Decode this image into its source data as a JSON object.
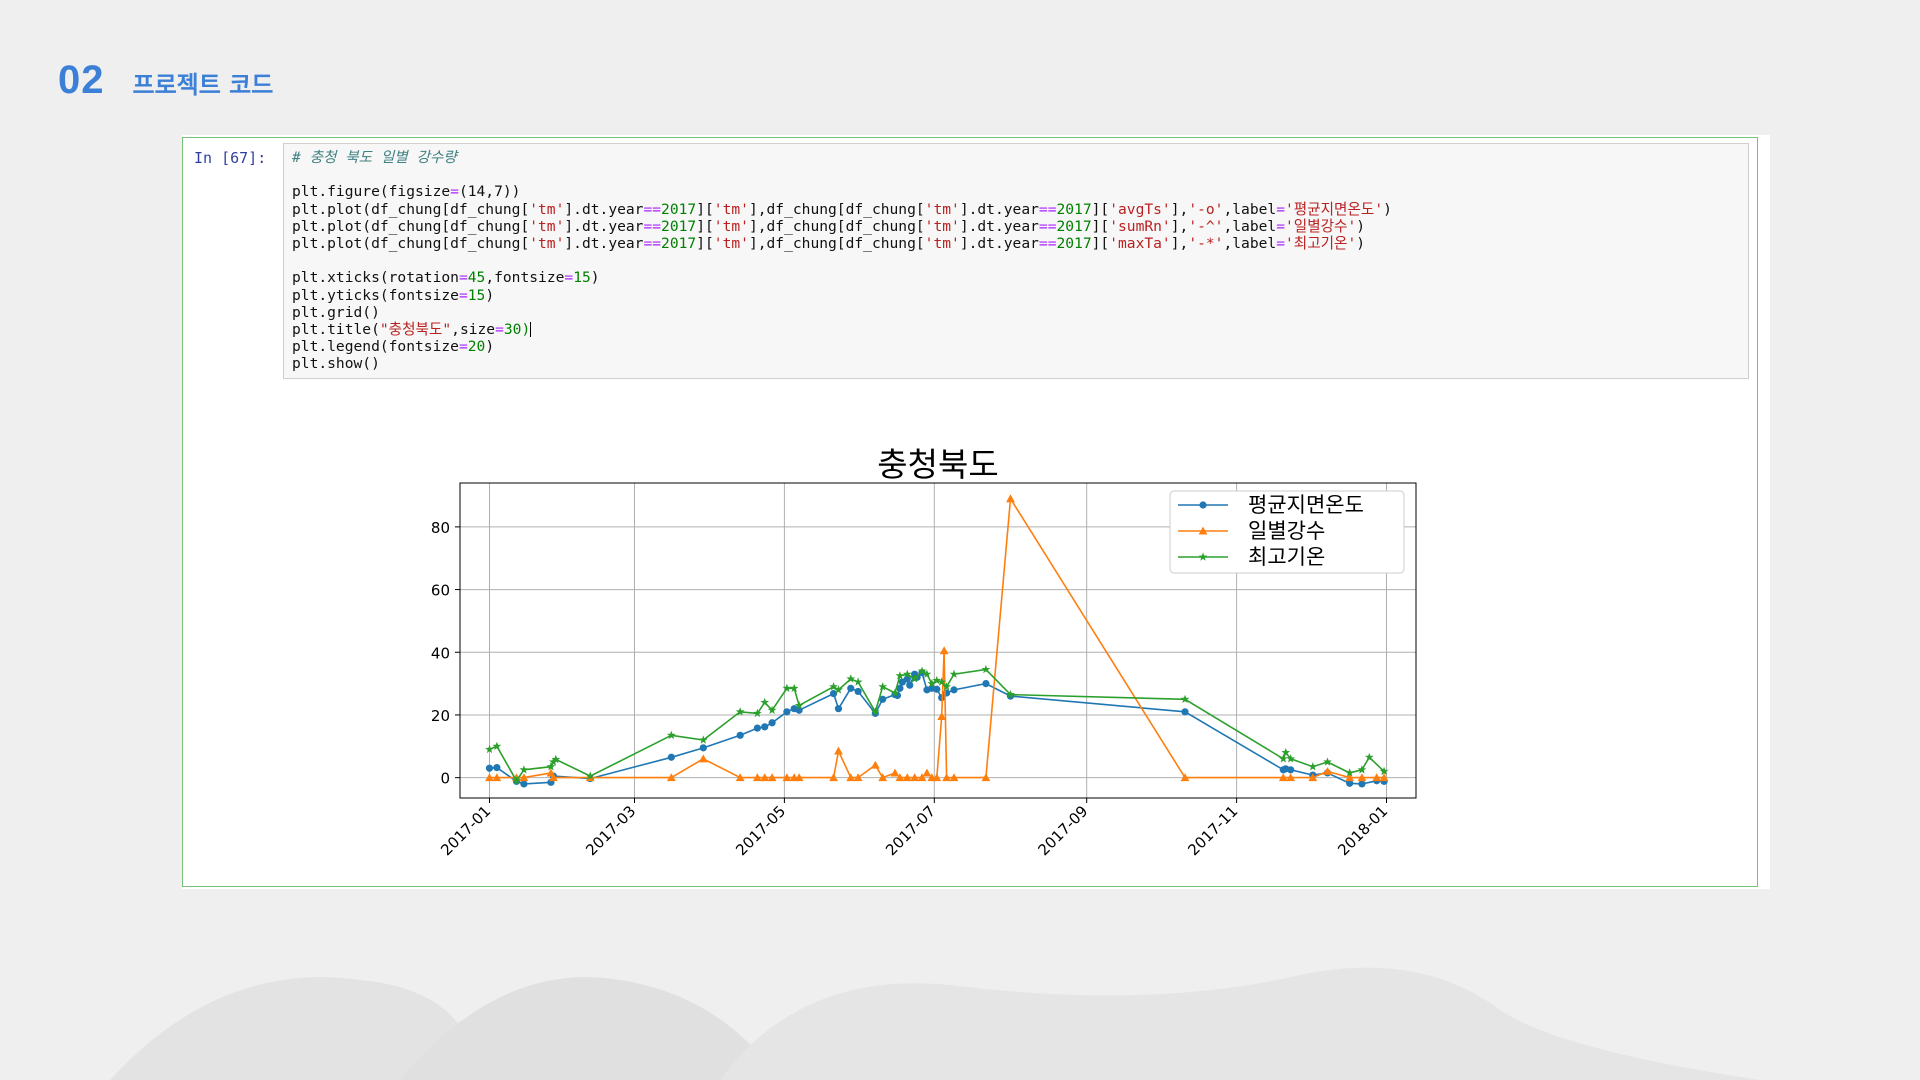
{
  "header": {
    "number": "02",
    "title": "프로젝트 코드"
  },
  "cell": {
    "prompt": "In [67]:",
    "lines": [
      [
        {
          "t": "# 충청 북도 일별 강수량",
          "c": "cm"
        }
      ],
      [],
      [
        {
          "t": "plt.figure(figsize",
          "c": ""
        },
        {
          "t": "=",
          "c": "op"
        },
        {
          "t": "(14,7))",
          "c": ""
        }
      ],
      [
        {
          "t": "plt.plot(df_chung[df_chung[",
          "c": ""
        },
        {
          "t": "'tm'",
          "c": "st"
        },
        {
          "t": "].dt.year",
          "c": ""
        },
        {
          "t": "==",
          "c": "op"
        },
        {
          "t": "2017",
          "c": "nm"
        },
        {
          "t": "][",
          "c": ""
        },
        {
          "t": "'tm'",
          "c": "st"
        },
        {
          "t": "],df_chung[df_chung[",
          "c": ""
        },
        {
          "t": "'tm'",
          "c": "st"
        },
        {
          "t": "].dt.year",
          "c": ""
        },
        {
          "t": "==",
          "c": "op"
        },
        {
          "t": "2017",
          "c": "nm"
        },
        {
          "t": "][",
          "c": ""
        },
        {
          "t": "'avgTs'",
          "c": "st"
        },
        {
          "t": "],",
          "c": ""
        },
        {
          "t": "'-o'",
          "c": "st"
        },
        {
          "t": ",label",
          "c": ""
        },
        {
          "t": "=",
          "c": "op"
        },
        {
          "t": "'평균지면온도'",
          "c": "st"
        },
        {
          "t": ")",
          "c": ""
        }
      ],
      [
        {
          "t": "plt.plot(df_chung[df_chung[",
          "c": ""
        },
        {
          "t": "'tm'",
          "c": "st"
        },
        {
          "t": "].dt.year",
          "c": ""
        },
        {
          "t": "==",
          "c": "op"
        },
        {
          "t": "2017",
          "c": "nm"
        },
        {
          "t": "][",
          "c": ""
        },
        {
          "t": "'tm'",
          "c": "st"
        },
        {
          "t": "],df_chung[df_chung[",
          "c": ""
        },
        {
          "t": "'tm'",
          "c": "st"
        },
        {
          "t": "].dt.year",
          "c": ""
        },
        {
          "t": "==",
          "c": "op"
        },
        {
          "t": "2017",
          "c": "nm"
        },
        {
          "t": "][",
          "c": ""
        },
        {
          "t": "'sumRn'",
          "c": "st"
        },
        {
          "t": "],",
          "c": ""
        },
        {
          "t": "'-^'",
          "c": "st"
        },
        {
          "t": ",label",
          "c": ""
        },
        {
          "t": "=",
          "c": "op"
        },
        {
          "t": "'일별강수'",
          "c": "st"
        },
        {
          "t": ")",
          "c": ""
        }
      ],
      [
        {
          "t": "plt.plot(df_chung[df_chung[",
          "c": ""
        },
        {
          "t": "'tm'",
          "c": "st"
        },
        {
          "t": "].dt.year",
          "c": ""
        },
        {
          "t": "==",
          "c": "op"
        },
        {
          "t": "2017",
          "c": "nm"
        },
        {
          "t": "][",
          "c": ""
        },
        {
          "t": "'tm'",
          "c": "st"
        },
        {
          "t": "],df_chung[df_chung[",
          "c": ""
        },
        {
          "t": "'tm'",
          "c": "st"
        },
        {
          "t": "].dt.year",
          "c": ""
        },
        {
          "t": "==",
          "c": "op"
        },
        {
          "t": "2017",
          "c": "nm"
        },
        {
          "t": "][",
          "c": ""
        },
        {
          "t": "'maxTa'",
          "c": "st"
        },
        {
          "t": "],",
          "c": ""
        },
        {
          "t": "'-*'",
          "c": "st"
        },
        {
          "t": ",label",
          "c": ""
        },
        {
          "t": "=",
          "c": "op"
        },
        {
          "t": "'최고기온'",
          "c": "st"
        },
        {
          "t": ")",
          "c": ""
        }
      ],
      [],
      [
        {
          "t": "plt.xticks(rotation",
          "c": ""
        },
        {
          "t": "=",
          "c": "op"
        },
        {
          "t": "45",
          "c": "nm"
        },
        {
          "t": ",fontsize",
          "c": ""
        },
        {
          "t": "=",
          "c": "op"
        },
        {
          "t": "15",
          "c": "nm"
        },
        {
          "t": ")",
          "c": ""
        }
      ],
      [
        {
          "t": "plt.yticks(fontsize",
          "c": ""
        },
        {
          "t": "=",
          "c": "op"
        },
        {
          "t": "15",
          "c": "nm"
        },
        {
          "t": ")",
          "c": ""
        }
      ],
      [
        {
          "t": "plt.grid()",
          "c": ""
        }
      ],
      [
        {
          "t": "plt.title(",
          "c": ""
        },
        {
          "t": "\"충청북도\"",
          "c": "st"
        },
        {
          "t": ",size",
          "c": ""
        },
        {
          "t": "=",
          "c": "op"
        },
        {
          "t": "30)",
          "c": "nm"
        },
        {
          "t": "",
          "c": "cursor"
        }
      ],
      [
        {
          "t": "plt.legend(fontsize",
          "c": ""
        },
        {
          "t": "=",
          "c": "op"
        },
        {
          "t": "20",
          "c": "nm"
        },
        {
          "t": ")",
          "c": ""
        }
      ],
      [
        {
          "t": "plt.show()",
          "c": ""
        }
      ]
    ]
  },
  "chart_data": {
    "type": "line",
    "title": "충청북도",
    "xlabel": "",
    "ylabel": "",
    "x_range": [
      "2016-12-20",
      "2018-01-13"
    ],
    "ylim": [
      -6.5,
      94
    ],
    "grid": true,
    "legend_position": "top-right",
    "xticks": [
      "2017-01",
      "2017-03",
      "2017-05",
      "2017-07",
      "2017-09",
      "2017-11",
      "2018-01"
    ],
    "yticks": [
      0,
      20,
      40,
      60,
      80
    ],
    "series": [
      {
        "name": "평균지면온도",
        "marker": "o",
        "color": "#1f77b4",
        "points": [
          [
            "2017-01-01",
            3
          ],
          [
            "2017-01-04",
            3.2
          ],
          [
            "2017-01-12",
            -1.2
          ],
          [
            "2017-01-15",
            -2
          ],
          [
            "2017-01-26",
            -1.5
          ],
          [
            "2017-01-27",
            0.5
          ],
          [
            "2017-02-11",
            -0.3
          ],
          [
            "2017-03-16",
            6.5
          ],
          [
            "2017-03-29",
            9.5
          ],
          [
            "2017-04-13",
            13.5
          ],
          [
            "2017-04-20",
            15.8
          ],
          [
            "2017-04-23",
            16.2
          ],
          [
            "2017-04-26",
            17.5
          ],
          [
            "2017-05-02",
            21
          ],
          [
            "2017-05-05",
            22
          ],
          [
            "2017-05-07",
            21.5
          ],
          [
            "2017-05-21",
            26.8
          ],
          [
            "2017-05-23",
            22
          ],
          [
            "2017-05-28",
            28.5
          ],
          [
            "2017-05-31",
            27.5
          ],
          [
            "2017-06-07",
            20.5
          ],
          [
            "2017-06-10",
            25
          ],
          [
            "2017-06-15",
            26.5
          ],
          [
            "2017-06-16",
            26.2
          ],
          [
            "2017-06-17",
            28.5
          ],
          [
            "2017-06-18",
            30.5
          ],
          [
            "2017-06-20",
            31.5
          ],
          [
            "2017-06-21",
            29.5
          ],
          [
            "2017-06-23",
            33
          ],
          [
            "2017-06-24",
            32
          ],
          [
            "2017-06-26",
            33.5
          ],
          [
            "2017-06-28",
            28
          ],
          [
            "2017-06-30",
            28.5
          ],
          [
            "2017-07-02",
            28.2
          ],
          [
            "2017-07-04",
            25.5
          ],
          [
            "2017-07-06",
            27
          ],
          [
            "2017-07-09",
            28
          ],
          [
            "2017-07-22",
            30
          ],
          [
            "2017-08-01",
            26
          ],
          [
            "2017-10-11",
            21
          ],
          [
            "2017-11-20",
            2.5
          ],
          [
            "2017-11-21",
            2.8
          ],
          [
            "2017-11-23",
            2.5
          ],
          [
            "2017-12-02",
            0.8
          ],
          [
            "2017-12-08",
            1.5
          ],
          [
            "2017-12-17",
            -1.8
          ],
          [
            "2017-12-22",
            -2
          ],
          [
            "2017-12-28",
            -1
          ],
          [
            "2017-12-31",
            -1.2
          ]
        ]
      },
      {
        "name": "일별강수",
        "marker": "^",
        "color": "#ff7f0e",
        "points": [
          [
            "2017-01-01",
            0
          ],
          [
            "2017-01-04",
            0
          ],
          [
            "2017-01-12",
            0
          ],
          [
            "2017-01-15",
            0
          ],
          [
            "2017-01-26",
            1.5
          ],
          [
            "2017-01-27",
            0
          ],
          [
            "2017-02-11",
            0
          ],
          [
            "2017-03-16",
            0
          ],
          [
            "2017-03-29",
            6
          ],
          [
            "2017-04-13",
            0
          ],
          [
            "2017-04-20",
            0
          ],
          [
            "2017-04-23",
            0
          ],
          [
            "2017-04-26",
            0
          ],
          [
            "2017-05-02",
            0
          ],
          [
            "2017-05-05",
            0
          ],
          [
            "2017-05-07",
            0
          ],
          [
            "2017-05-21",
            0
          ],
          [
            "2017-05-23",
            8.5
          ],
          [
            "2017-05-28",
            0
          ],
          [
            "2017-05-31",
            0
          ],
          [
            "2017-06-07",
            4
          ],
          [
            "2017-06-10",
            0
          ],
          [
            "2017-06-15",
            1.5
          ],
          [
            "2017-06-17",
            0
          ],
          [
            "2017-06-20",
            0
          ],
          [
            "2017-06-23",
            0
          ],
          [
            "2017-06-26",
            0
          ],
          [
            "2017-06-28",
            1.5
          ],
          [
            "2017-06-30",
            0
          ],
          [
            "2017-07-02",
            0
          ],
          [
            "2017-07-04",
            19.5
          ],
          [
            "2017-07-05",
            40.5
          ],
          [
            "2017-07-06",
            0
          ],
          [
            "2017-07-09",
            0
          ],
          [
            "2017-07-22",
            0
          ],
          [
            "2017-08-01",
            89
          ],
          [
            "2017-10-11",
            0
          ],
          [
            "2017-11-20",
            0
          ],
          [
            "2017-11-23",
            0
          ],
          [
            "2017-12-02",
            0
          ],
          [
            "2017-12-08",
            2
          ],
          [
            "2017-12-17",
            0
          ],
          [
            "2017-12-22",
            0
          ],
          [
            "2017-12-28",
            0
          ],
          [
            "2017-12-31",
            0
          ]
        ]
      },
      {
        "name": "최고기온",
        "marker": "*",
        "color": "#2ca02c",
        "points": [
          [
            "2017-01-01",
            9
          ],
          [
            "2017-01-04",
            10
          ],
          [
            "2017-01-12",
            -1
          ],
          [
            "2017-01-15",
            2.5
          ],
          [
            "2017-01-26",
            3.5
          ],
          [
            "2017-01-27",
            5
          ],
          [
            "2017-01-28",
            5.8
          ],
          [
            "2017-02-11",
            0.5
          ],
          [
            "2017-03-16",
            13.5
          ],
          [
            "2017-03-29",
            12
          ],
          [
            "2017-04-13",
            21
          ],
          [
            "2017-04-20",
            20.5
          ],
          [
            "2017-04-23",
            24
          ],
          [
            "2017-04-26",
            21.5
          ],
          [
            "2017-05-02",
            28.5
          ],
          [
            "2017-05-05",
            28.5
          ],
          [
            "2017-05-07",
            23
          ],
          [
            "2017-05-21",
            29
          ],
          [
            "2017-05-23",
            28
          ],
          [
            "2017-05-28",
            31.5
          ],
          [
            "2017-05-31",
            30.5
          ],
          [
            "2017-06-07",
            21
          ],
          [
            "2017-06-10",
            29
          ],
          [
            "2017-06-15",
            27
          ],
          [
            "2017-06-17",
            32.5
          ],
          [
            "2017-06-20",
            33
          ],
          [
            "2017-06-23",
            31.5
          ],
          [
            "2017-06-26",
            34
          ],
          [
            "2017-06-28",
            33
          ],
          [
            "2017-06-30",
            30
          ],
          [
            "2017-07-02",
            31
          ],
          [
            "2017-07-04",
            30.5
          ],
          [
            "2017-07-06",
            29
          ],
          [
            "2017-07-09",
            33
          ],
          [
            "2017-07-22",
            34.5
          ],
          [
            "2017-08-01",
            26.5
          ],
          [
            "2017-10-11",
            25
          ],
          [
            "2017-11-20",
            6
          ],
          [
            "2017-11-21",
            8
          ],
          [
            "2017-11-23",
            6
          ],
          [
            "2017-12-02",
            3.5
          ],
          [
            "2017-12-08",
            5
          ],
          [
            "2017-12-17",
            1.5
          ],
          [
            "2017-12-22",
            2.5
          ],
          [
            "2017-12-25",
            6.5
          ],
          [
            "2017-12-31",
            2
          ]
        ]
      }
    ]
  }
}
